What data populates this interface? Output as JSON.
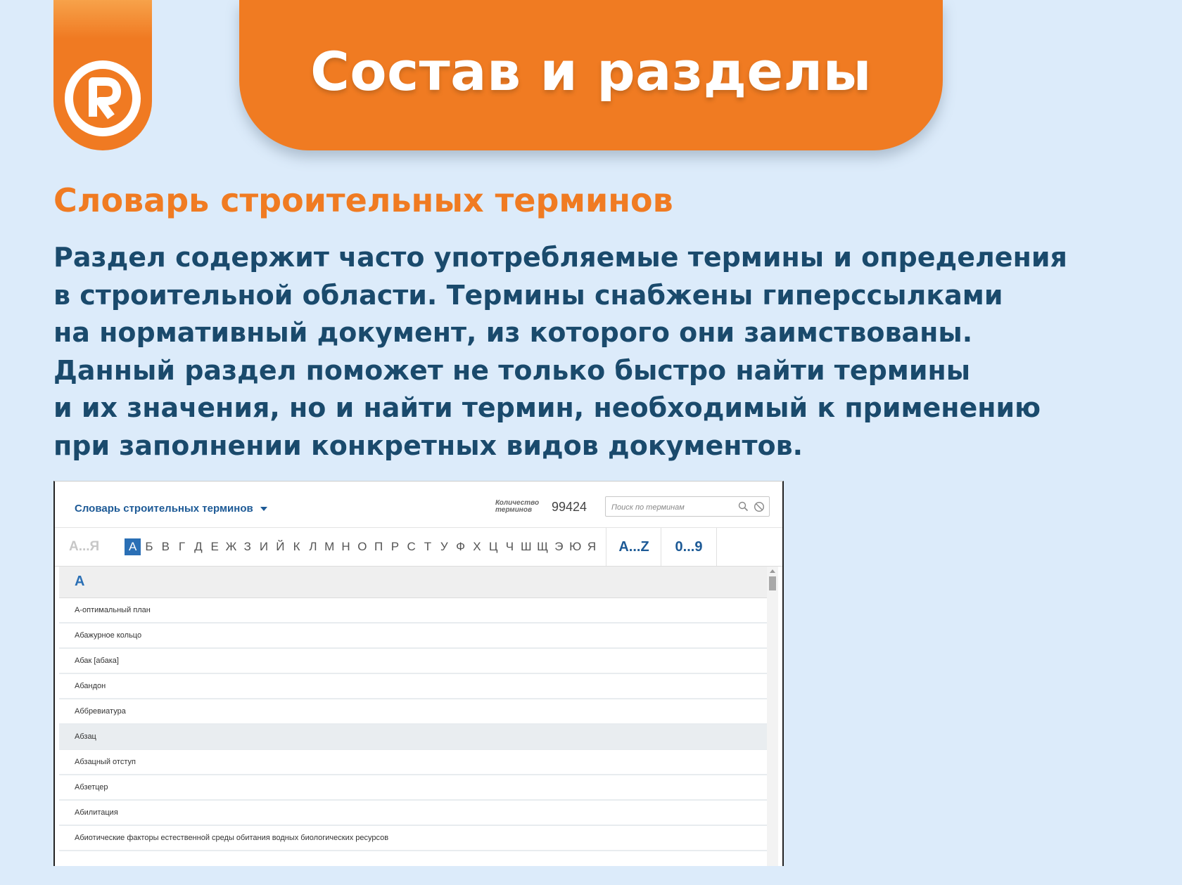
{
  "banner": {
    "title": "Состав и разделы"
  },
  "logo": {
    "letter": "R",
    "color": "#f07b22"
  },
  "section": {
    "title": "Словарь строительных терминов"
  },
  "description": {
    "lines": [
      "Раздел содержит часто употребляемые термины и определения",
      "в строительной области. Термины снабжены гиперссылками",
      "на нормативный документ, из которого они заимствованы.",
      "Данный раздел поможет не только быстро найти термины",
      "и их значения, но и найти термин, необходимый к применению",
      "при заполнении конкретных видов документов."
    ]
  },
  "app": {
    "dictionary_select": "Словарь строительных терминов",
    "count_label_1": "Количество",
    "count_label_2": "терминов",
    "count_value": "99424",
    "search_placeholder": "Поиск по терминам",
    "alpha_ru_tab": "А...Я",
    "letters": [
      "А",
      "Б",
      "В",
      "Г",
      "Д",
      "Е",
      "Ж",
      "З",
      "И",
      "Й",
      "К",
      "Л",
      "М",
      "Н",
      "О",
      "П",
      "Р",
      "С",
      "Т",
      "У",
      "Ф",
      "Х",
      "Ц",
      "Ч",
      "Ш",
      "Щ",
      "Э",
      "Ю",
      "Я"
    ],
    "active_letter": "А",
    "tab_latin": "A...Z",
    "tab_digits": "0...9",
    "group_letter": "А",
    "terms": [
      "А-оптимальный план",
      "Абажурное кольцо",
      "Абак [абака]",
      "Абандон",
      "Аббревиатура",
      "Абзац",
      "Абзацный отступ",
      "Абзетцер",
      "Абилитация",
      "Абиотические факторы естественной среды обитания водных биологических ресурсов"
    ],
    "highlighted_term": "Абзац",
    "accent_color": "#2a6fb5"
  }
}
